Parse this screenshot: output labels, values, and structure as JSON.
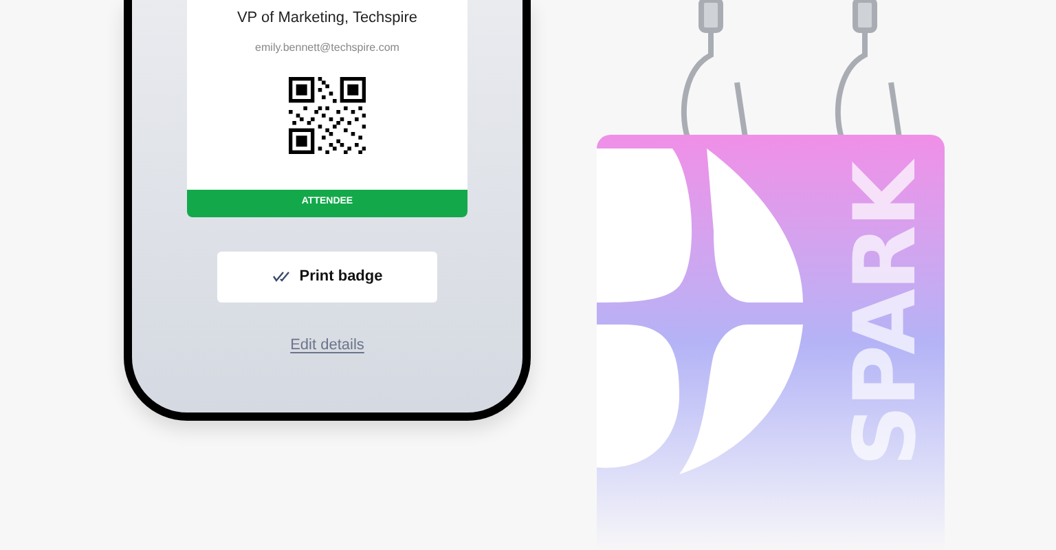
{
  "badge_card": {
    "title": "VP of Marketing, Techspire",
    "email": "emily.bennett@techspire.com",
    "role": "ATTENDEE"
  },
  "actions": [
    {
      "kind": "primary",
      "label": "Print badge"
    },
    {
      "kind": "link",
      "label": "Edit details"
    }
  ],
  "lanyard_badge": {
    "brand": "SPARK"
  }
}
